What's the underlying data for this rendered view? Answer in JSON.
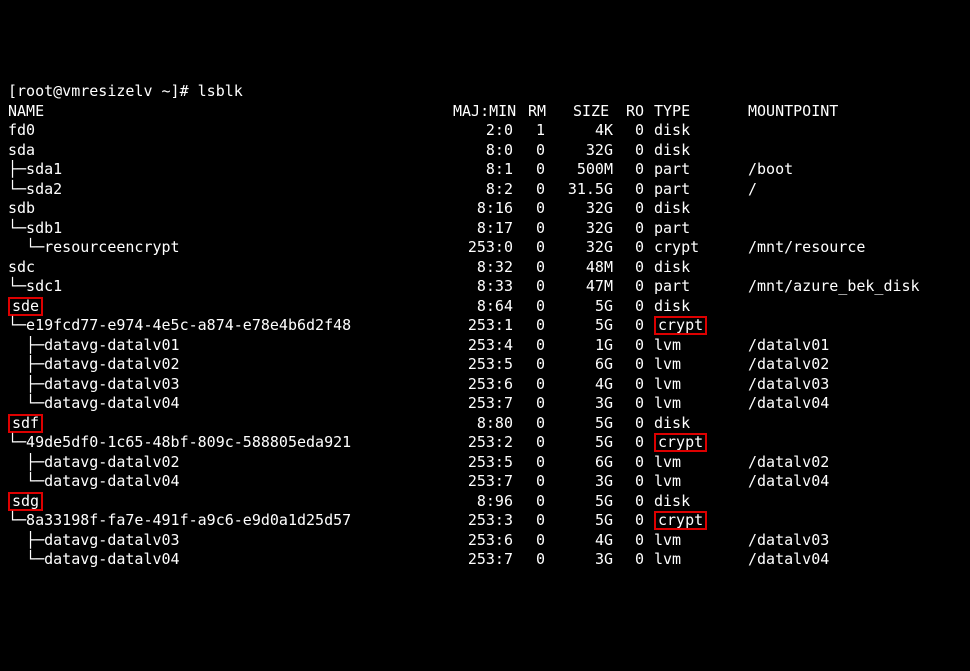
{
  "prompt": "[root@vmresizelv ~]# ",
  "command": "lsblk",
  "headers": {
    "name": "NAME",
    "majmin": "MAJ:MIN",
    "rm": "RM",
    "size": "SIZE",
    "ro": "RO",
    "type": "TYPE",
    "mnt": "MOUNTPOINT"
  },
  "rows": [
    {
      "name": "fd0",
      "majmin": "2:0",
      "rm": "1",
      "size": "4K",
      "ro": "0",
      "type": "disk",
      "mnt": ""
    },
    {
      "name": "sda",
      "majmin": "8:0",
      "rm": "0",
      "size": "32G",
      "ro": "0",
      "type": "disk",
      "mnt": ""
    },
    {
      "name": "├─sda1",
      "majmin": "8:1",
      "rm": "0",
      "size": "500M",
      "ro": "0",
      "type": "part",
      "mnt": "/boot"
    },
    {
      "name": "└─sda2",
      "majmin": "8:2",
      "rm": "0",
      "size": "31.5G",
      "ro": "0",
      "type": "part",
      "mnt": "/"
    },
    {
      "name": "sdb",
      "majmin": "8:16",
      "rm": "0",
      "size": "32G",
      "ro": "0",
      "type": "disk",
      "mnt": ""
    },
    {
      "name": "└─sdb1",
      "majmin": "8:17",
      "rm": "0",
      "size": "32G",
      "ro": "0",
      "type": "part",
      "mnt": ""
    },
    {
      "name": "  └─resourceencrypt",
      "majmin": "253:0",
      "rm": "0",
      "size": "32G",
      "ro": "0",
      "type": "crypt",
      "mnt": "/mnt/resource"
    },
    {
      "name": "sdc",
      "majmin": "8:32",
      "rm": "0",
      "size": "48M",
      "ro": "0",
      "type": "disk",
      "mnt": ""
    },
    {
      "name": "└─sdc1",
      "majmin": "8:33",
      "rm": "0",
      "size": "47M",
      "ro": "0",
      "type": "part",
      "mnt": "/mnt/azure_bek_disk"
    },
    {
      "name": "sde",
      "nameBox": true,
      "majmin": "8:64",
      "rm": "0",
      "size": "5G",
      "ro": "0",
      "type": "disk",
      "mnt": ""
    },
    {
      "name": "└─e19fcd77-e974-4e5c-a874-e78e4b6d2f48",
      "majmin": "253:1",
      "rm": "0",
      "size": "5G",
      "ro": "0",
      "type": "crypt",
      "typeBox": true,
      "mnt": ""
    },
    {
      "name": "  ├─datavg-datalv01",
      "majmin": "253:4",
      "rm": "0",
      "size": "1G",
      "ro": "0",
      "type": "lvm",
      "mnt": "/datalv01"
    },
    {
      "name": "  ├─datavg-datalv02",
      "majmin": "253:5",
      "rm": "0",
      "size": "6G",
      "ro": "0",
      "type": "lvm",
      "mnt": "/datalv02"
    },
    {
      "name": "  ├─datavg-datalv03",
      "majmin": "253:6",
      "rm": "0",
      "size": "4G",
      "ro": "0",
      "type": "lvm",
      "mnt": "/datalv03"
    },
    {
      "name": "  └─datavg-datalv04",
      "majmin": "253:7",
      "rm": "0",
      "size": "3G",
      "ro": "0",
      "type": "lvm",
      "mnt": "/datalv04"
    },
    {
      "name": "sdf",
      "nameBox": true,
      "majmin": "8:80",
      "rm": "0",
      "size": "5G",
      "ro": "0",
      "type": "disk",
      "mnt": ""
    },
    {
      "name": "└─49de5df0-1c65-48bf-809c-588805eda921",
      "majmin": "253:2",
      "rm": "0",
      "size": "5G",
      "ro": "0",
      "type": "crypt",
      "typeBox": true,
      "mnt": ""
    },
    {
      "name": "  ├─datavg-datalv02",
      "majmin": "253:5",
      "rm": "0",
      "size": "6G",
      "ro": "0",
      "type": "lvm",
      "mnt": "/datalv02"
    },
    {
      "name": "  └─datavg-datalv04",
      "majmin": "253:7",
      "rm": "0",
      "size": "3G",
      "ro": "0",
      "type": "lvm",
      "mnt": "/datalv04"
    },
    {
      "name": "sdg",
      "nameBox": true,
      "majmin": "8:96",
      "rm": "0",
      "size": "5G",
      "ro": "0",
      "type": "disk",
      "mnt": ""
    },
    {
      "name": "└─8a33198f-fa7e-491f-a9c6-e9d0a1d25d57",
      "majmin": "253:3",
      "rm": "0",
      "size": "5G",
      "ro": "0",
      "type": "crypt",
      "typeBox": true,
      "mnt": ""
    },
    {
      "name": "  ├─datavg-datalv03",
      "majmin": "253:6",
      "rm": "0",
      "size": "4G",
      "ro": "0",
      "type": "lvm",
      "mnt": "/datalv03"
    },
    {
      "name": "  └─datavg-datalv04",
      "majmin": "253:7",
      "rm": "0",
      "size": "3G",
      "ro": "0",
      "type": "lvm",
      "mnt": "/datalv04"
    }
  ]
}
